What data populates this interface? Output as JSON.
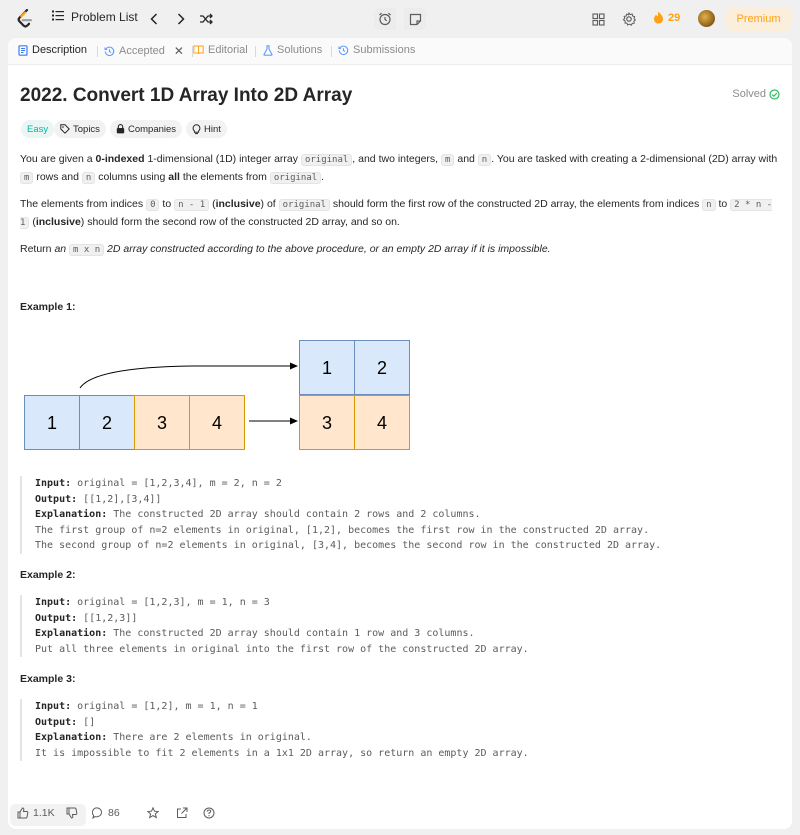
{
  "topbar": {
    "problem_list_label": "Problem List",
    "streak_count": "29",
    "premium_label": "Premium"
  },
  "tabs": [
    {
      "label": "Description"
    },
    {
      "label": "Accepted"
    },
    {
      "label": "Editorial"
    },
    {
      "label": "Solutions"
    },
    {
      "label": "Submissions"
    }
  ],
  "problem": {
    "title": "2022. Convert 1D Array Into 2D Array",
    "status": "Solved",
    "difficulty": "Easy",
    "chips": {
      "topics": "Topics",
      "companies": "Companies",
      "hint": "Hint"
    },
    "p1": {
      "a": "You are given a ",
      "b": "0-indexed",
      "c": " 1-dimensional (1D) integer array ",
      "code1": "original",
      "d": ", and two integers, ",
      "code2": "m",
      "e": " and ",
      "code3": "n",
      "f": ". You are tasked with creating a 2-dimensional (2D) array with ",
      "code4": "m",
      "g": " rows and ",
      "code5": "n",
      "h": " columns using ",
      "i": "all",
      "j": " the elements from ",
      "code6": "original",
      "k": "."
    },
    "p2": {
      "a": "The elements from indices ",
      "code1": "0",
      "b": " to ",
      "code2": "n - 1",
      "c": " (",
      "d": "inclusive",
      "e": ") of ",
      "code3": "original",
      "f": " should form the first row of the constructed 2D array, the elements from indices ",
      "code4": "n",
      "g": " to ",
      "code5": "2 * n - 1",
      "h": " (",
      "i": "inclusive",
      "j": ") should form the second row of the constructed 2D array, and so on."
    },
    "p3": {
      "a": "Return ",
      "b": "an ",
      "code1": "m x n",
      "c": " 2D array constructed according to the above procedure, or an empty 2D array if it is impossible."
    }
  },
  "diagram": {
    "row1d": [
      "1",
      "2",
      "3",
      "4"
    ],
    "grid": [
      [
        "1",
        "2"
      ],
      [
        "3",
        "4"
      ]
    ],
    "colors": {
      "blue_fill": "#dae8fc",
      "blue_stroke": "#6c8ebf",
      "orange_fill": "#ffe6cc",
      "orange_stroke": "#d79b00"
    }
  },
  "examples": [
    {
      "heading": "Example 1:",
      "input_label": "Input:",
      "input": " original = [1,2,3,4], m = 2, n = 2",
      "output_label": "Output:",
      "output": " [[1,2],[3,4]]",
      "explanation_label": "Explanation:",
      "explanation": " The constructed 2D array should contain 2 rows and 2 columns.",
      "lines": [
        "The first group of n=2 elements in original, [1,2], becomes the first row in the constructed 2D array.",
        "The second group of n=2 elements in original, [3,4], becomes the second row in the constructed 2D array."
      ]
    },
    {
      "heading": "Example 2:",
      "input_label": "Input:",
      "input": " original = [1,2,3], m = 1, n = 3",
      "output_label": "Output:",
      "output": " [[1,2,3]]",
      "explanation_label": "Explanation:",
      "explanation": " The constructed 2D array should contain 1 row and 3 columns.",
      "lines": [
        "Put all three elements in original into the first row of the constructed 2D array."
      ]
    },
    {
      "heading": "Example 3:",
      "input_label": "Input:",
      "input": " original = [1,2], m = 1, n = 1",
      "output_label": "Output:",
      "output": " []",
      "explanation_label": "Explanation:",
      "explanation": " There are 2 elements in original.",
      "lines": [
        "It is impossible to fit 2 elements in a 1x1 2D array, so return an empty 2D array."
      ]
    }
  ],
  "bottom": {
    "likes": "1.1K",
    "comments": "86"
  },
  "colors": {
    "accent": "#ffa116",
    "easy": "#00b8a3",
    "solved": "#2cbb5d"
  }
}
